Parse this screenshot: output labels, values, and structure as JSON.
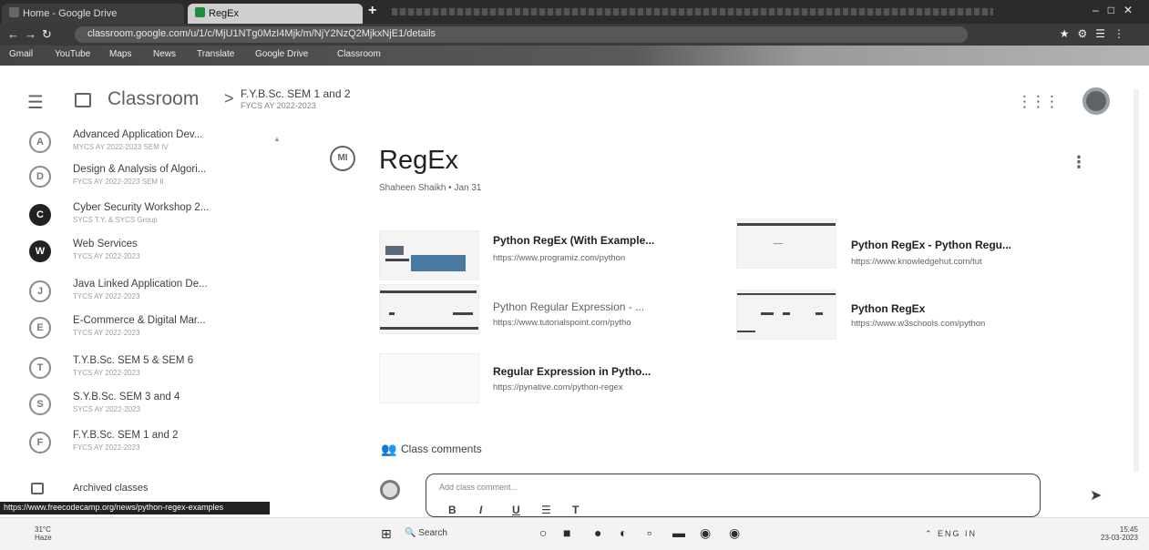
{
  "browser": {
    "tabs": [
      {
        "label": "Home - Google Drive"
      },
      {
        "label": "RegEx"
      }
    ],
    "new_tab": "+",
    "url": "classroom.google.com/u/1/c/MjU1NTg0MzI4Mjk/m/NjY2NzQ2MjkxNjE1/details",
    "bookmarks": [
      "Gmail",
      "YouTube",
      "Maps",
      "News",
      "Translate",
      "Google Drive",
      "Classroom"
    ]
  },
  "header": {
    "app_title": "Classroom",
    "breadcrumb_sep": ">",
    "class_title": "F.Y.B.Sc. SEM 1 and 2",
    "class_subtitle": "FYCS AY 2022-2023"
  },
  "sidebar": {
    "items": [
      {
        "avatar": "A",
        "name": "Advanced Application Dev...",
        "sub": "MYCS AY 2022-2023 SEM IV",
        "dark": false
      },
      {
        "avatar": "D",
        "name": "Design & Analysis of Algori...",
        "sub": "FYCS AY 2022-2023 SEM II",
        "dark": false
      },
      {
        "avatar": "C",
        "name": "Cyber Security Workshop 2...",
        "sub": "SYCS T.Y. & SYCS Group",
        "dark": true
      },
      {
        "avatar": "W",
        "name": "Web Services",
        "sub": "TYCS AY 2022-2023",
        "dark": true
      },
      {
        "avatar": "J",
        "name": "Java Linked Application De...",
        "sub": "TYCS AY 2022-2023",
        "dark": false
      },
      {
        "avatar": "E",
        "name": "E-Commerce & Digital Mar...",
        "sub": "TYCS AY 2022-2023",
        "dark": false
      },
      {
        "avatar": "T",
        "name": "T.Y.B.Sc. SEM 5 & SEM 6",
        "sub": "TYCS AY 2022-2023",
        "dark": false
      },
      {
        "avatar": "S",
        "name": "S.Y.B.Sc. SEM 3 and 4",
        "sub": "SYCS AY 2022-2023",
        "dark": false
      },
      {
        "avatar": "F",
        "name": "F.Y.B.Sc. SEM 1 and 2",
        "sub": "FYCS AY 2022-2023",
        "dark": false
      }
    ],
    "archived_label": "Archived classes",
    "status_url": "https://www.freecodecamp.org/news/python-regex-examples"
  },
  "material": {
    "avatar": "MI",
    "title": "RegEx",
    "meta": "Shaheen Shaikh • Jan 31",
    "attachments": [
      {
        "title": "Python RegEx (With Example...",
        "url": "https://www.programiz.com/python",
        "light": false
      },
      {
        "title": "Python RegEx - Python Regu...",
        "url": "https://www.knowledgehut.com/tut",
        "light": false
      },
      {
        "title": "Python Regular Expression - ...",
        "url": "https://www.tutorialspoint.com/pytho",
        "light": true
      },
      {
        "title": "Python RegEx",
        "url": "https://www.w3schools.com/python",
        "light": false
      },
      {
        "title": "Regular Expression in Pytho...",
        "url": "https://pynative.com/python-regex",
        "light": false
      }
    ]
  },
  "comments": {
    "label": "Class comments",
    "placeholder": "Add class comment...",
    "formatting": [
      "B",
      "I",
      "U",
      "☰",
      "T"
    ]
  },
  "taskbar": {
    "weather": [
      "31°C",
      "Haze"
    ],
    "search_label": "Search",
    "tray_text": "⌃  ENG  IN",
    "time": "15:45",
    "date": "23-03-2023"
  }
}
